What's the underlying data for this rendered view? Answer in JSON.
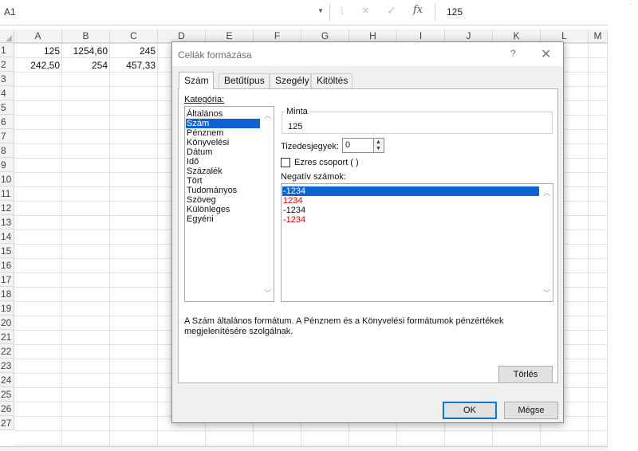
{
  "formula_bar": {
    "name_box": "A1",
    "cancel_icon": "×",
    "enter_icon": "✓",
    "fx_label": "fx",
    "value": "125"
  },
  "columns": [
    "A",
    "B",
    "C",
    "D",
    "E",
    "F",
    "G",
    "H",
    "I",
    "J",
    "K",
    "L",
    "M"
  ],
  "rows": [
    "1",
    "2",
    "3",
    "4",
    "5",
    "6",
    "7",
    "8",
    "9",
    "10",
    "11",
    "12",
    "13",
    "14",
    "15",
    "16",
    "17",
    "18",
    "19",
    "20",
    "21",
    "22",
    "23",
    "24",
    "25",
    "26",
    "27"
  ],
  "cells": {
    "A1": "125",
    "B1": "1254,60",
    "C1": "245",
    "A2": "242,50",
    "B2": "254",
    "C2": "457,33"
  },
  "dialog": {
    "title": "Cellák formázása",
    "help": "?",
    "close": "✕",
    "tabs": [
      {
        "label": "Szám",
        "active": true
      },
      {
        "label": "Betűtípus",
        "active": false
      },
      {
        "label": "Szegély",
        "active": false
      },
      {
        "label": "Kitöltés",
        "active": false
      }
    ],
    "category_label": "Kategória:",
    "categories": [
      "Általános",
      "Szám",
      "Pénznem",
      "Könyvelési",
      "Dátum",
      "Idő",
      "Százalék",
      "Tört",
      "Tudományos",
      "Szöveg",
      "Különleges",
      "Egyéni"
    ],
    "selected_category": "Szám",
    "sample_label": "Minta",
    "sample_value": "125",
    "decimals_label": "Tizedesjegyek:",
    "decimals_value": "0",
    "thousands_label": "Ezres csoport ( )",
    "thousands_checked": false,
    "negative_label": "Negatív számok:",
    "negative_options": [
      {
        "text": "-1234",
        "color": "#ffffff",
        "selected": true
      },
      {
        "text": "1234",
        "color": "#d00000",
        "selected": false
      },
      {
        "text": "-1234",
        "color": "#111111",
        "selected": false
      },
      {
        "text": "-1234",
        "color": "#d00000",
        "selected": false
      }
    ],
    "description": "A Szám általános formátum. A Pénznem és a Könyvelési formátumok pénzértékek megjelenítésére szolgálnak.",
    "delete_button": "Törlés",
    "ok_button": "OK",
    "cancel_button": "Mégse"
  },
  "colors": {
    "selection": "#0a64d2",
    "negative_red": "#d00000",
    "ok_border": "#0078d7"
  }
}
